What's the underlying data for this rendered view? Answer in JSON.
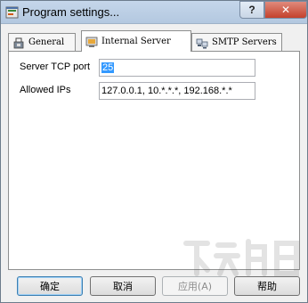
{
  "window": {
    "title": "Program settings...",
    "help_glyph": "?",
    "close_glyph": "✕"
  },
  "tabs": [
    {
      "label": "General",
      "icon": "general-icon"
    },
    {
      "label": "Internal Server",
      "icon": "server-icon",
      "active": true
    },
    {
      "label": "SMTP Servers",
      "icon": "smtp-servers-icon"
    }
  ],
  "form": {
    "port_label": "Server TCP port",
    "port_value": "25",
    "allowed_label": "Allowed IPs",
    "allowed_value": "127.0.0.1, 10.*.*.*, 192.168.*.*"
  },
  "buttons": {
    "ok": "确定",
    "cancel": "取消",
    "apply": "应用(A)",
    "help": "帮助"
  }
}
